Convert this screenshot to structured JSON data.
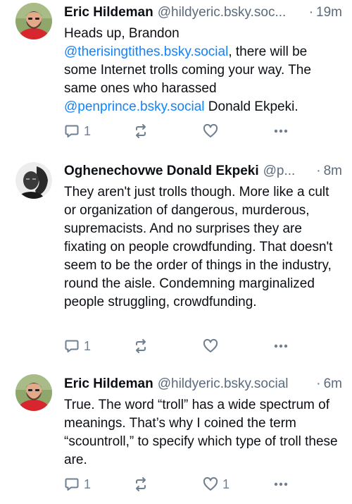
{
  "posts": [
    {
      "author": "Eric Hildeman",
      "handle": "@hildyeric.bsky.soc...",
      "separator": "·",
      "time": "19m",
      "avatar_icon": "profile-photo-bearded-man-red-shirt",
      "text_parts": [
        {
          "text": "Heads up, Brandon ",
          "type": "text"
        },
        {
          "text": "@therisingtithes.bsky.social",
          "type": "mention"
        },
        {
          "text": ", there will be some Internet trolls coming your way. The same ones who harassed ",
          "type": "text"
        },
        {
          "text": "@penprince.bsky.social",
          "type": "mention"
        },
        {
          "text": " Donald Ekpeki.",
          "type": "text"
        }
      ],
      "reply_count": "1",
      "repost_count": "",
      "like_count": ""
    },
    {
      "author": "Oghenechovwe Donald Ekpeki",
      "handle": "@p...",
      "separator": "·",
      "time": "8m",
      "avatar_icon": "profile-photo-black-and-white",
      "text_parts": [
        {
          "text": "They aren't just trolls though. More like a cult or organization of dangerous, murderous, supremacists. And no surprises they are fixating on people crowdfunding. That doesn't seem to be the order of things in the industry, round the aisle. Condemning marginalized people struggling, crowdfunding.",
          "type": "text"
        }
      ],
      "reply_count": "1",
      "repost_count": "",
      "like_count": ""
    },
    {
      "author": "Eric Hildeman",
      "handle": "@hildyeric.bsky.social",
      "separator": "·",
      "time": "6m",
      "avatar_icon": "profile-photo-bearded-man-red-shirt",
      "text_parts": [
        {
          "text": "True. The word “troll” has a wide spectrum of meanings. That’s why I coined the term “scountroll,” to specify which type of troll these are.",
          "type": "text"
        }
      ],
      "reply_count": "1",
      "repost_count": "",
      "like_count": "1"
    }
  ],
  "icons": {
    "reply": "reply-icon",
    "repost": "repost-icon",
    "like": "heart-icon",
    "more": "more-options-icon"
  },
  "colors": {
    "mention": "#1083fe",
    "secondary_text": "#5b6b7c",
    "action_icon": "#6f7f90"
  }
}
